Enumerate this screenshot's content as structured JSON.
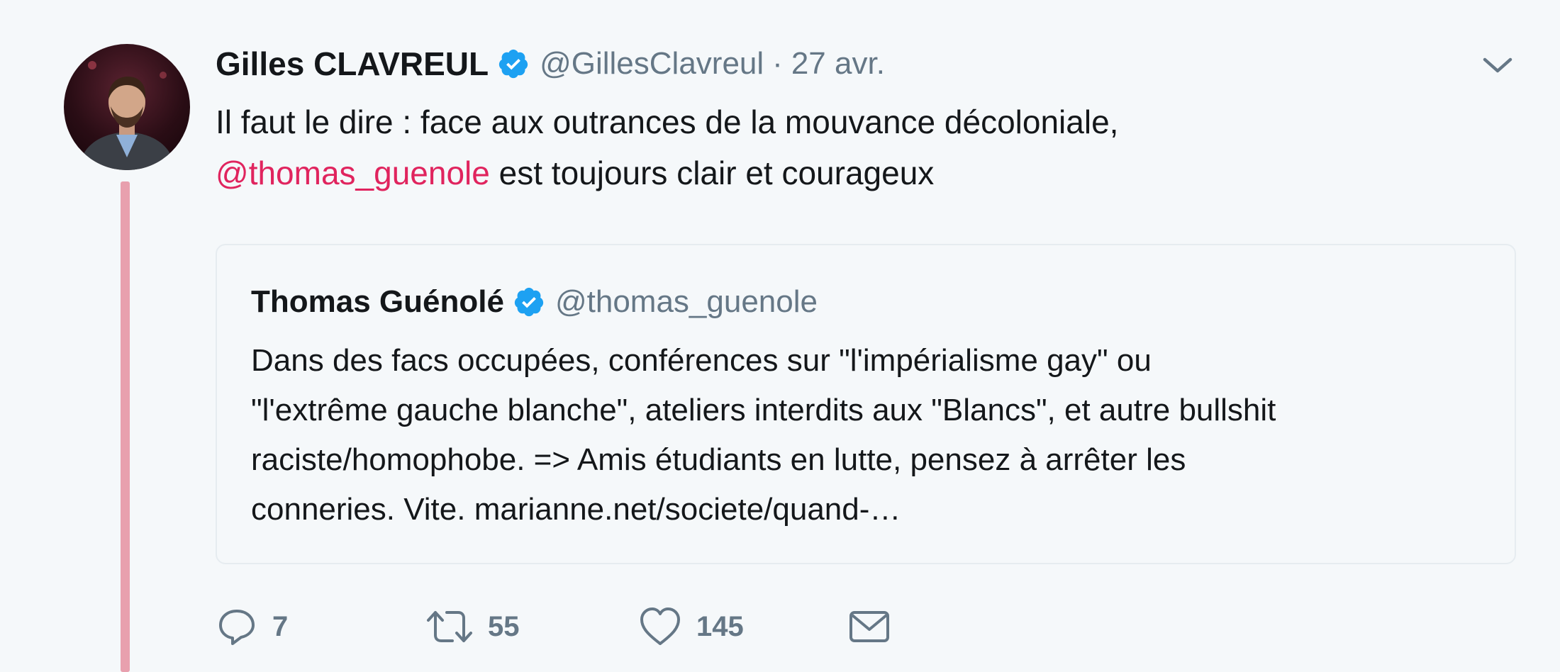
{
  "tweet": {
    "author_name": "Gilles CLAVREUL",
    "handle": "@GillesClavreul",
    "separator": "·",
    "date": "27 avr.",
    "text_line1": "Il faut le dire : face aux outrances de la mouvance décoloniale,",
    "mention": "@thomas_guenole",
    "text_after_mention": " est toujours clair et courageux",
    "quoted": {
      "author_name": "Thomas Guénolé",
      "handle": "@thomas_guenole",
      "text_line1": "Dans des facs occupées, conférences sur \"l'impérialisme gay\" ou",
      "text_line2": "\"l'extrême gauche blanche\", ateliers interdits aux \"Blancs\", et autre bullshit",
      "text_line3": "raciste/homophobe. => Amis étudiants en lutte, pensez à arrêter les",
      "text_line4": "conneries. Vite. marianne.net/societe/quand-…"
    },
    "actions": {
      "reply_count": "7",
      "retweet_count": "55",
      "like_count": "145"
    }
  },
  "icons": {
    "verified": "verified-badge-icon",
    "caret": "chevron-down-icon",
    "reply": "reply-icon",
    "retweet": "retweet-icon",
    "like": "heart-icon",
    "dm": "envelope-icon"
  },
  "colors": {
    "background": "#f5f8fa",
    "text": "#14171a",
    "secondary": "#657786",
    "mention": "#e0245e",
    "verified": "#1da1f2",
    "thread_line": "#e8a0ae",
    "quote_border": "#e6ecf0"
  }
}
